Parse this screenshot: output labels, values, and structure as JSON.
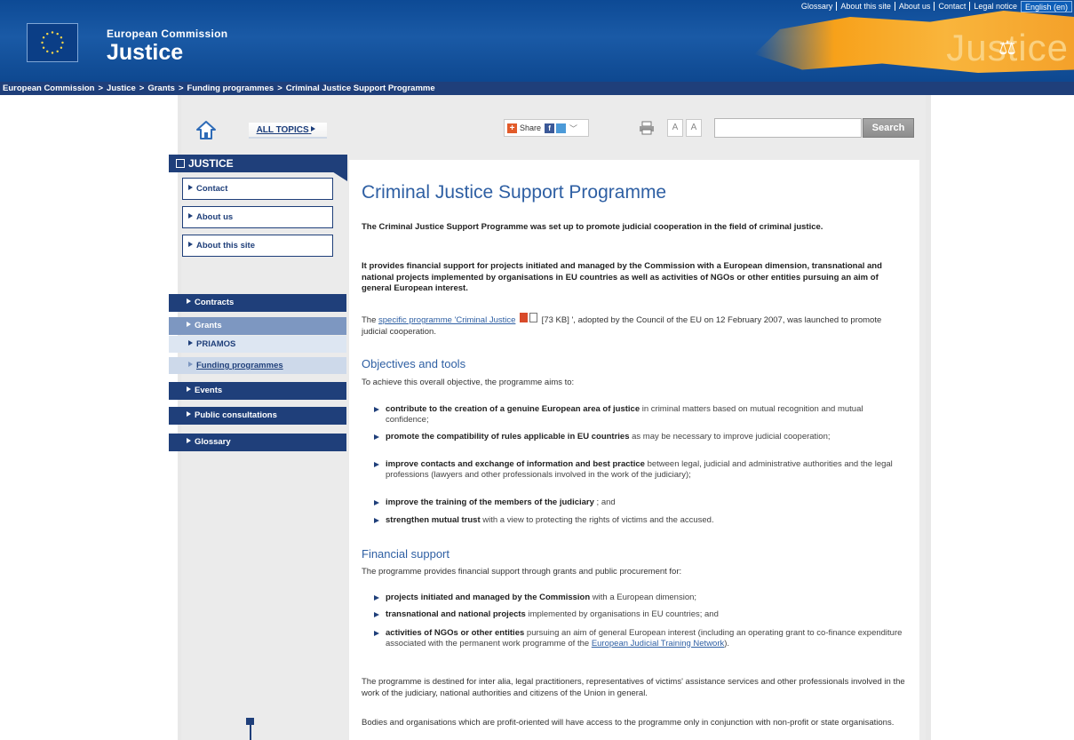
{
  "header": {
    "dg_name": "European Commission",
    "site_name": "Justice",
    "banner_word": "Justice",
    "top_links": [
      "Glossary",
      "About this site",
      "About us",
      "Contact",
      "Legal notice"
    ],
    "language": "English (en)",
    "accent_color": "#1f3f7a"
  },
  "breadcrumb": [
    "European Commission",
    "Justice",
    "Grants",
    "Funding programmes",
    "Criminal Justice Support Programme"
  ],
  "toolbar": {
    "all_topics": "ALL TOPICS",
    "share_label": "Share",
    "font_larger": "A",
    "font_smaller": "A",
    "search_placeholder": "",
    "search_button": "Search"
  },
  "nav": {
    "heading": "JUSTICE",
    "boxes": [
      "Contact",
      "About us",
      "About this site"
    ],
    "items": [
      {
        "label": "Contracts"
      },
      {
        "label": "Grants"
      },
      {
        "label": "PRIAMOS"
      },
      {
        "label": "Funding programmes"
      },
      {
        "label": "Events"
      },
      {
        "label": "Public consultations"
      },
      {
        "label": "Glossary"
      }
    ]
  },
  "content": {
    "title": "Criminal Justice Support Programme",
    "intro_1": "The Criminal Justice Support Programme was set up to promote judicial cooperation in the field of criminal justice.",
    "intro_2": "It provides financial support for projects initiated and managed by the Commission with a European dimension, transnational and national projects implemented by organisations in EU countries as well as activities of NGOs or other entities pursuing an aim of general European interest.",
    "para_1_pre": "The ",
    "para_1_link": "specific programme 'Criminal Justice",
    "para_1_size": " [73 KB] ",
    "para_1_post": "', adopted by the Council of the EU on 12 February 2007, was launched to promote judicial cooperation.",
    "objectives_heading": "Objectives and tools",
    "objectives_lead": "To achieve this overall objective, the programme aims to:",
    "objectives": [
      {
        "bold": "contribute to the creation of a genuine European area of justice",
        "rest": " in criminal matters based on mutual recognition and mutual confidence;"
      },
      {
        "bold": "promote the compatibility of rules applicable in EU countries",
        "rest": " as may be necessary to improve judicial cooperation;"
      },
      {
        "bold": "improve contacts and exchange of information and best practice",
        "rest": " between legal, judicial and administrative authorities and the legal professions (lawyers and other professionals involved in the work of the judiciary);"
      },
      {
        "bold": "improve the training of the members of the judiciary",
        "rest": " ; and"
      },
      {
        "bold": "strengthen mutual trust",
        "rest": " with a view to protecting the rights of victims and the accused."
      }
    ],
    "financial_heading": "Financial support",
    "financial_lead": "The programme provides financial support through grants and public procurement for:",
    "financial": [
      {
        "bold": "projects initiated and managed by the Commission",
        "rest": " with a European dimension;"
      },
      {
        "bold": "transnational and national projects",
        "rest": " implemented by organisations in EU countries; and"
      },
      {
        "bold": "activities of NGOs or other entities",
        "rest": " pursuing an aim of general European interest (including an operating grant to co-finance expenditure associated with the permanent work programme of the ",
        "link": "European Judicial Training Network",
        "end": ")."
      }
    ],
    "para_2": "The programme is destined for inter alia, legal practitioners, representatives of victims' assistance services and other professionals involved in the work of the judiciary, national authorities and citizens of the Union in general.",
    "para_3": "Bodies and organisations which are profit-oriented will have access to the programme only in conjunction with non-profit or state organisations."
  }
}
